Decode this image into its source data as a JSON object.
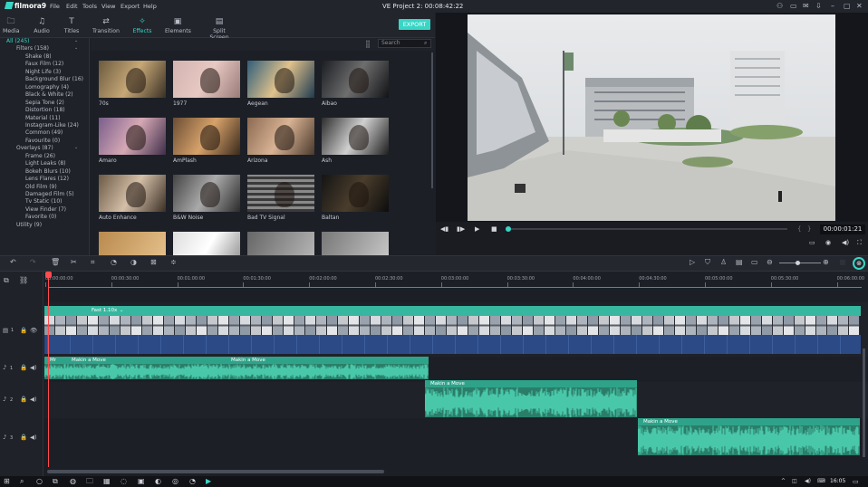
{
  "app": {
    "logo": "filmora9",
    "menu": [
      "File",
      "Edit",
      "Tools",
      "View",
      "Export",
      "Help"
    ],
    "project_title": "VE Project 2:  00:08:42:22"
  },
  "tabs": [
    "Media",
    "Audio",
    "Titles",
    "Transition",
    "Effects",
    "Elements",
    "Split Screen"
  ],
  "active_tab": "Effects",
  "export_label": "EXPORT",
  "sidebar": {
    "items": [
      "All (245)",
      "Filters (158)",
      "Shake (8)",
      "Faux Film (12)",
      "Night Life (3)",
      "Background Blur (16)",
      "Lomography (4)",
      "Black & White (2)",
      "Sepia Tone (2)",
      "Distortion (18)",
      "Material (11)",
      "Instagram-Like (24)",
      "Common (49)",
      "Favourite (0)",
      "Overlays (87)",
      "Frame (26)",
      "Light Leaks (8)",
      "Bokeh Blurs (10)",
      "Lens Flares (12)",
      "Old Film (9)",
      "Damaged Film (5)",
      "Tv Static (10)",
      "View Finder (7)",
      "Favorite (0)",
      "Utility (9)"
    ]
  },
  "search": {
    "placeholder": "Search"
  },
  "effects": [
    "70s",
    "1977",
    "Aegean",
    "Aibao",
    "Amaro",
    "AmPlash",
    "Arizona",
    "Ash",
    "Auto Enhance",
    "B&W Noise",
    "Bad TV Signal",
    "Baltan"
  ],
  "preview": {
    "timecode": "00:00:01:21",
    "seek_progress": 0.0
  },
  "timeline": {
    "ruler": [
      "00:00:00:00",
      "00:00:30:00",
      "00:01:00:00",
      "00:01:30:00",
      "00:02:00:00",
      "00:02:30:00",
      "00:03:00:00",
      "00:03:30:00",
      "00:04:00:00",
      "00:04:30:00",
      "00:05:00:00",
      "00:05:30:00",
      "00:06:00:00"
    ],
    "video_clip_label": "Fast 1.10x",
    "tracks": [
      {
        "icon": "video-track-icon",
        "num": "1"
      },
      {
        "icon": "music-track-icon",
        "num": "1"
      },
      {
        "icon": "music-track-icon",
        "num": "2"
      },
      {
        "icon": "music-track-icon",
        "num": "3"
      }
    ],
    "audio_clips": [
      {
        "labels": [
          "Mr",
          "Makin a Move",
          "Makin a Move"
        ]
      },
      {
        "labels": [
          "Makin a Move"
        ]
      },
      {
        "labels": [
          "Makin a Move"
        ]
      }
    ]
  },
  "taskbar": {
    "clock": "16:05"
  },
  "colors": {
    "accent": "#39d6c6",
    "playhead": "#ff4b4b",
    "audio": "#2fa38a",
    "video_blue": "#2b4a86"
  }
}
